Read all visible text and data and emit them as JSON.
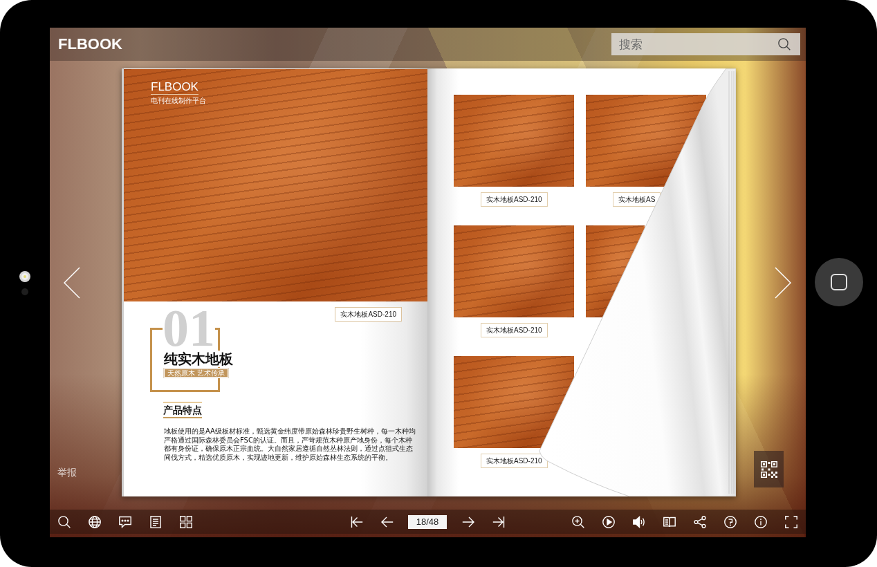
{
  "top_bar": {
    "logo": "FLBOOK",
    "search": {
      "placeholder": "搜索"
    }
  },
  "left_page": {
    "photo_caption": {
      "brand": "FLBOOK",
      "tagline": "电刊在线制作平台"
    },
    "model_tag": "实木地板ASD-210",
    "number": "01",
    "title": "纯实木地板",
    "subtitle": "天然原木 艺术传承",
    "section_heading": "产品特点",
    "paragraph": "地板使用的是AA级板材标准，甄选黄金纬度带原始森林珍贵野生树种，每一木种均严格通过国际森林委员会FSC的认证。而且，严苛规范木种原产地身份，每个木种都有身份证，确保原木正宗血统。大自然家居遵循自然丛林法则，通过点狙式生态间伐方式，精选优质原木，实现迹地更新，维护原始森林生态系统的平衡。"
  },
  "right_page": {
    "products": [
      {
        "kind": "full",
        "label": "实木地板ASD-210"
      },
      {
        "kind": "full",
        "label": "实木地板AS"
      },
      {
        "kind": "full",
        "label": "实木地板ASD-210"
      },
      {
        "kind": "partial"
      },
      {
        "kind": "full",
        "label": "实木地板ASD-210"
      }
    ]
  },
  "report_link": "举报",
  "toolbar": {
    "page_field": {
      "value": "18/48"
    }
  }
}
